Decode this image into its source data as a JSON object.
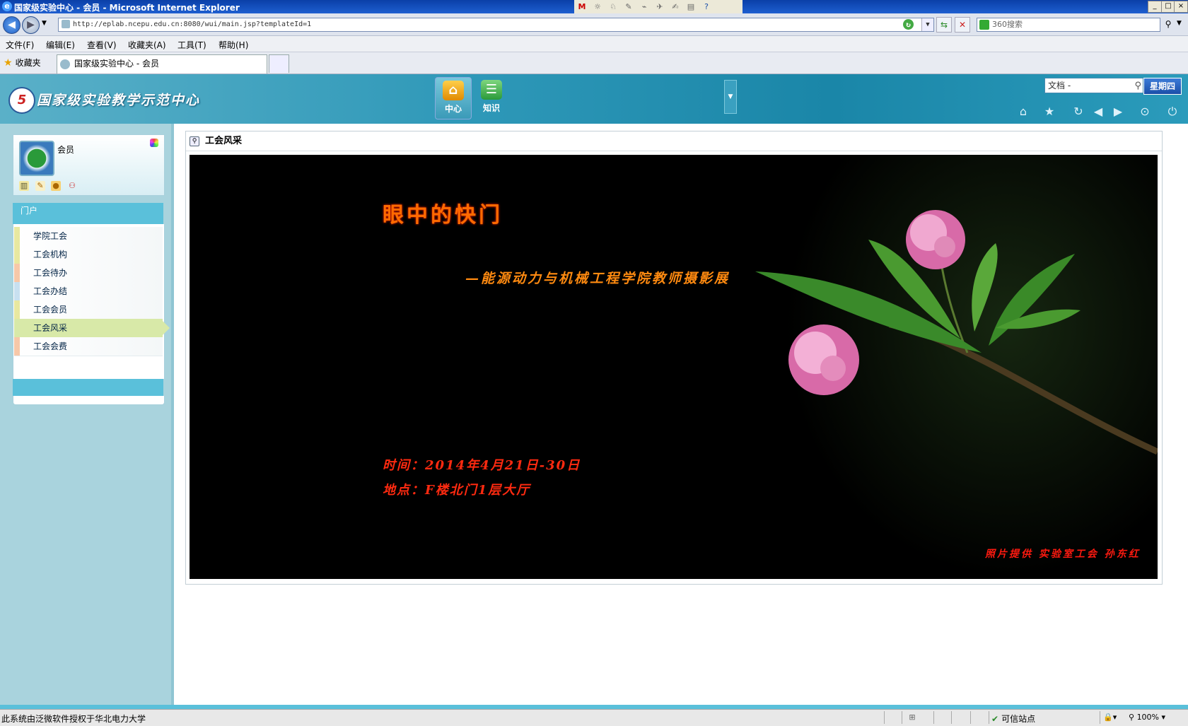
{
  "window": {
    "title": "国家级实验中心 - 会员 - Microsoft Internet Explorer",
    "minimize": "_",
    "maximize": "□",
    "close": "×"
  },
  "browser": {
    "url": "http://eplab.ncepu.edu.cn:8080/wui/main.jsp?templateId=1",
    "search_placeholder": "360搜索",
    "menu": [
      "文件(F)",
      "编辑(E)",
      "查看(V)",
      "收藏夹(A)",
      "工具(T)",
      "帮助(H)"
    ],
    "favorites_label": "收藏夹",
    "tab_title": "国家级实验中心 - 会员"
  },
  "header": {
    "site_name": "国家级实验教学示范中心",
    "logo_text": "5",
    "nav": [
      {
        "label": "中心",
        "icon": "home-icon"
      },
      {
        "label": "知识",
        "icon": "knowledge-icon"
      }
    ],
    "doc_search_value": "文档 -",
    "weekday": "星期四",
    "toolbar_icons": [
      "home-icon",
      "favorite-icon",
      "refresh-icon",
      "back-icon",
      "forward-icon",
      "settings-icon",
      "power-icon"
    ]
  },
  "user": {
    "name": "会员"
  },
  "portal": {
    "header": "门户",
    "items": [
      {
        "label": "学院工会",
        "color": "#e8e8a0",
        "active": false
      },
      {
        "label": "工会机构",
        "color": "#e8e8a0",
        "active": false
      },
      {
        "label": "工会待办",
        "color": "#f7c8a8",
        "active": false
      },
      {
        "label": "工会办结",
        "color": "#c8e0f0",
        "active": false
      },
      {
        "label": "工会会员",
        "color": "#e8e8a0",
        "active": false
      },
      {
        "label": "工会风采",
        "color": "#d8e9a8",
        "active": true
      },
      {
        "label": "工会会费",
        "color": "#f7c8a8",
        "active": false
      }
    ]
  },
  "content": {
    "portlet_title": "工会风采",
    "banner": {
      "title": "眼中的快门",
      "subtitle": "—能源动力与机械工程学院教师摄影展",
      "time": "时间：2014年4月21日-30日",
      "place": "地点：F楼北门1层大厅",
      "credit": "照片提供 实验室工会 孙东红"
    }
  },
  "status": {
    "text": "此系统由泛微软件授权于华北电力大学",
    "zone": "可信站点",
    "zoom": "100%"
  }
}
